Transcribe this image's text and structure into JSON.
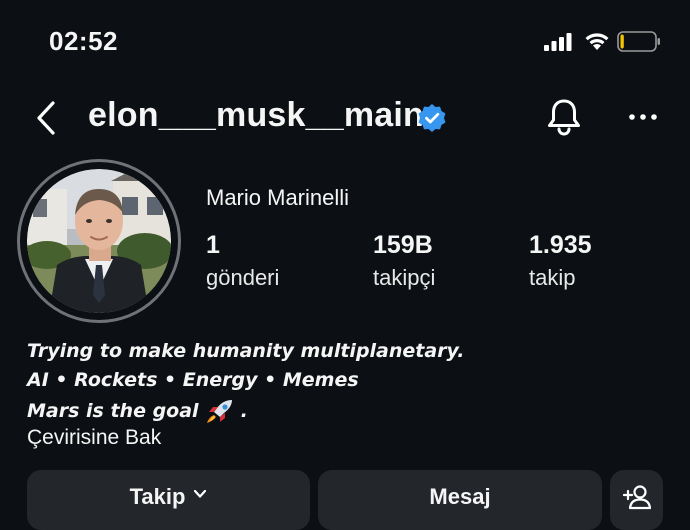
{
  "status_bar": {
    "time": "02:52",
    "signal_icon": "cellular-signal-icon",
    "wifi_icon": "wifi-icon",
    "battery_icon": "battery-low-icon",
    "battery_level": 0.1
  },
  "header": {
    "username": "elon___musk__main",
    "verified": true,
    "verified_color": "#3797f0",
    "back_icon": "back-chevron-icon",
    "bell_icon": "bell-icon",
    "more_icon": "more-horizontal-icon"
  },
  "profile": {
    "display_name": "Mario Marinelli",
    "stats": [
      {
        "value": "1",
        "label": "gönderi"
      },
      {
        "value": "159B",
        "label": "takipçi"
      },
      {
        "value": "1.935",
        "label": "takip"
      }
    ]
  },
  "bio": {
    "lines": [
      "Trying to make humanity multiplanetary.",
      "AI • Rockets • Energy • Memes",
      "Mars is the goal"
    ],
    "line3_suffix": ".",
    "rocket_icon": "rocket-emoji-icon",
    "translate_label": "Çevirisine Bak"
  },
  "actions": {
    "follow_label": "Takip",
    "message_label": "Mesaj",
    "add_person_icon": "add-person-icon"
  }
}
